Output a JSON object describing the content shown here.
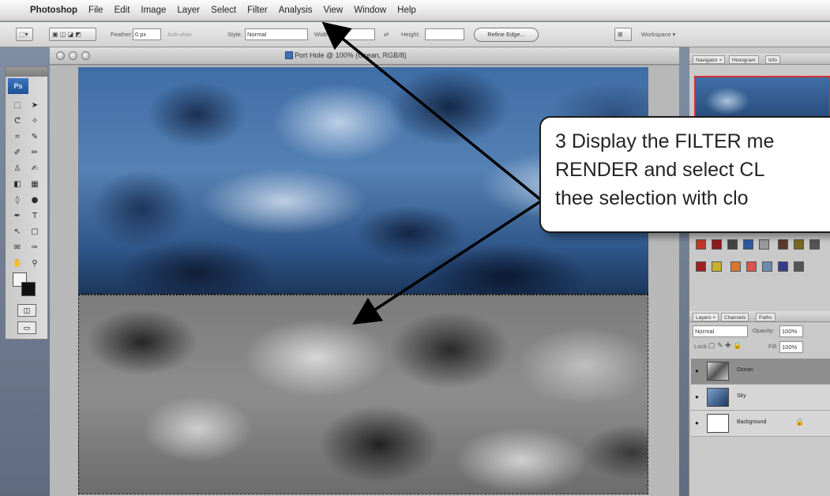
{
  "menubar": {
    "apple_icon": "apple-icon",
    "app": "Photoshop",
    "items": [
      "File",
      "Edit",
      "Image",
      "Layer",
      "Select",
      "Filter",
      "Analysis",
      "View",
      "Window",
      "Help"
    ]
  },
  "options_bar": {
    "feather_label": "Feather:",
    "feather_value": "0 px",
    "antialias": "Anti-alias",
    "style_label": "Style:",
    "style_value": "Normal",
    "width_label": "Width:",
    "height_label": "Height:",
    "refine_edge": "Refine Edge...",
    "workspace": "Workspace ▾"
  },
  "tools": {
    "logo": "Ps"
  },
  "document": {
    "title": "Port Hole @ 100% (Ocean, RGB/8)"
  },
  "panels": {
    "top_tabs": [
      "Navigator ×",
      "Histogram",
      "Info"
    ],
    "layer_tabs": [
      "Layers ×",
      "Channels",
      "Paths"
    ],
    "blend_mode": "Normal",
    "opacity_label": "Opacity:",
    "opacity_value": "100%",
    "lock_label": "Lock:",
    "fill_label": "Fill:",
    "fill_value": "100%",
    "layers": [
      {
        "name": "Ocean",
        "active": true
      },
      {
        "name": "Sky",
        "active": false
      },
      {
        "name": "Background",
        "active": false
      }
    ]
  },
  "callout": {
    "text": "3  Display the FILTER me\n    RENDER and select CL\n    thee selection with clo"
  },
  "colors": {
    "callout_border": "#1a1a1a",
    "arrow": "#000000",
    "accent_selection": "#d43030"
  }
}
